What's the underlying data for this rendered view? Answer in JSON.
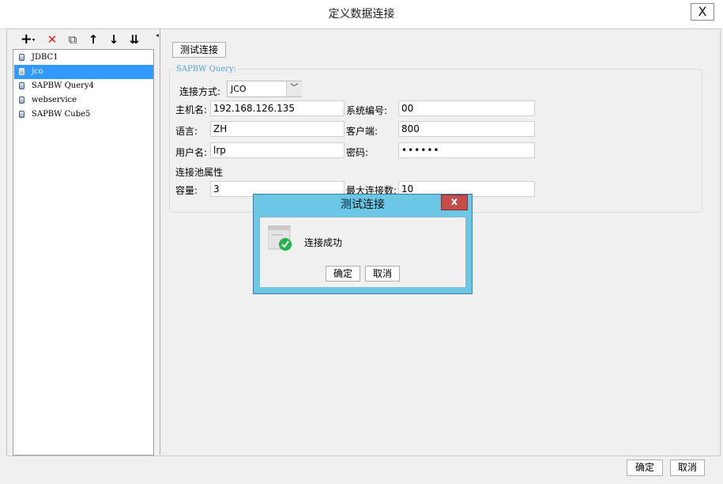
{
  "window": {
    "title": "定义数据连接",
    "close_glyph": "X"
  },
  "toolbar": {
    "add_glyph": "+",
    "delete_glyph": "✕",
    "copy_glyph": "⧉",
    "up_glyph": "↑",
    "down_glyph": "↓",
    "sort_glyph": "⇊"
  },
  "connections": [
    {
      "label": "JDBC1"
    },
    {
      "label": "jco",
      "selected": true
    },
    {
      "label": "SAPBW Query4"
    },
    {
      "label": "webservice"
    },
    {
      "label": "SAPBW Cube5"
    }
  ],
  "form": {
    "test_button": "测试连接",
    "group_title": "SAPBW Query:",
    "connection_mode_label": "连接方式:",
    "connection_mode_value": "JCO",
    "host_label": "主机名:",
    "host_value": "192.168.126.135",
    "system_no_label": "系统编号:",
    "system_no_value": "00",
    "language_label": "语言:",
    "language_value": "ZH",
    "client_label": "客户端:",
    "client_value": "800",
    "user_label": "用户名:",
    "user_value": "lrp",
    "password_label": "密码:",
    "password_value": "••••••",
    "pool_label": "连接池属性",
    "capacity_label": "容量:",
    "capacity_value": "3",
    "max_conn_label": "最大连接数:",
    "max_conn_value": "10"
  },
  "dialog": {
    "title": "测试连接",
    "close_glyph": "x",
    "message": "连接成功",
    "ok_label": "确定",
    "cancel_label": "取消"
  },
  "footer": {
    "ok_label": "确定",
    "cancel_label": "取消"
  }
}
